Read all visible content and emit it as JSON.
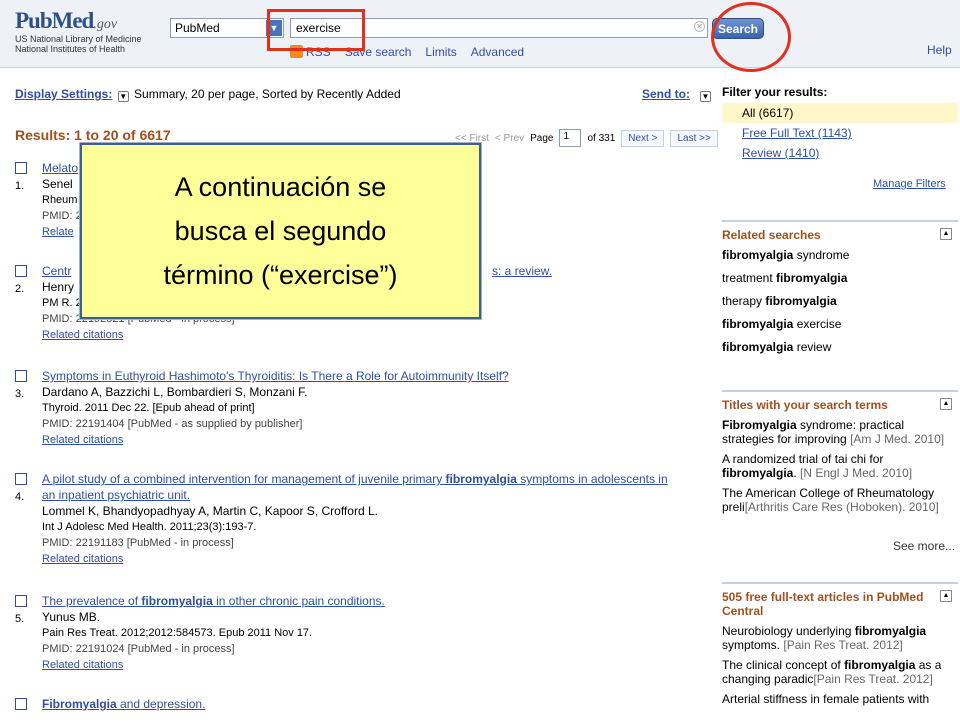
{
  "header": {
    "logo_main": "PubMed",
    "logo_suffix": ".gov",
    "logo_line1": "US National Library of Medicine",
    "logo_line2": "National Institutes of Health",
    "db_select": "PubMed",
    "search_value": "exercise",
    "search_button": "Search",
    "sublinks": [
      "RSS",
      "Save search",
      "Limits",
      "Advanced"
    ],
    "help": "Help"
  },
  "display": {
    "label": "Display Settings:",
    "summary": "Summary, 20 per page, Sorted by Recently Added",
    "send_to": "Send to:"
  },
  "results_header": "Results: 1 to 20 of 6617",
  "pager": {
    "first": "<< First",
    "prev": "< Prev",
    "page_label": "Page",
    "page_value": "1",
    "of": "of 331",
    "next": "Next >",
    "last": "Last >>"
  },
  "callout": {
    "line1": "A continuación se",
    "line2": "busca el segundo",
    "line3": "término (“exercise”)"
  },
  "results": [
    {
      "num": "1.",
      "title": "Melato",
      "authors": "Senel",
      "journal": "Rheum",
      "pmid": "PMID: 2",
      "related": "Relate"
    },
    {
      "num": "2.",
      "title_start": "Centr",
      "title_end": "s: a review.",
      "authors": "Henry",
      "journal": "PM R. 2",
      "pmid": "PMID: 22192321 [PubMed - in process]",
      "related": "Related citations"
    },
    {
      "num": "3.",
      "title": "Symptoms in Euthyroid Hashimoto's Thyroiditis: Is There a Role for Autoimmunity Itself?",
      "authors": "Dardano A, Bazzichi L, Bombardieri S, Monzani F.",
      "journal": "Thyroid. 2011 Dec 22. [Epub ahead of print]",
      "pmid": "PMID: 22191404 [PubMed - as supplied by publisher]",
      "related": "Related citations"
    },
    {
      "num": "4.",
      "title_a": "A pilot study of a combined intervention for management of juvenile primary ",
      "title_b": "fibromyalgia",
      "title_c": " symptoms in adolescents in an inpatient psychiatric unit.",
      "authors": "Lommel K, Bhandyopadhyay A, Martin C, Kapoor S, Crofford L.",
      "journal": "Int J Adolesc Med Health. 2011;23(3):193-7.",
      "pmid": "PMID: 22191183 [PubMed - in process]",
      "related": "Related citations"
    },
    {
      "num": "5.",
      "title_a": "The prevalence of ",
      "title_b": "fibromyalgia",
      "title_c": " in other chronic pain conditions.",
      "authors": "Yunus MB.",
      "journal": "Pain Res Treat. 2012;2012:584573. Epub 2011 Nov 17.",
      "pmid": "PMID: 22191024 [PubMed - in process]",
      "related": "Related citations"
    },
    {
      "num": "6.",
      "title_b": "Fibromyalgia",
      "title_c": " and depression."
    }
  ],
  "sidebar": {
    "filter_title": "Filter your results:",
    "filters": [
      "All (6617)",
      "Free Full Text (1143)",
      "Review (1410)"
    ],
    "manage_filters": "Manage Filters",
    "related_title": "Related searches",
    "related": [
      {
        "b": "fibromyalgia",
        "t": " syndrome"
      },
      {
        "t": "treatment ",
        "b": "fibromyalgia"
      },
      {
        "t": "therapy ",
        "b": "fibromyalgia"
      },
      {
        "b": "fibromyalgia",
        "t": " exercise"
      },
      {
        "b": "fibromyalgia",
        "t": " review"
      }
    ],
    "titles_title": "Titles with your search terms",
    "titles": [
      {
        "b": "Fibromyalgia",
        "t": " syndrome: practical strategies for improving ",
        "src": "[Am J Med. 2010]"
      },
      {
        "t": "A randomized trial of tai chi for ",
        "b": "fibromyalgia",
        "t2": ".",
        "src": "[N Engl J Med. 2010]"
      },
      {
        "t": "The American College of Rheumatology preli",
        "src": "[Arthritis Care Res (Hoboken). 2010]"
      }
    ],
    "see_more": "See more...",
    "pmc_title": "505 free full-text articles in PubMed Central",
    "pmc": [
      {
        "t": "Neurobiology underlying ",
        "b": "fibromyalgia",
        "t2": " symptoms.",
        "src": "[Pain Res Treat. 2012]"
      },
      {
        "t": "The clinical concept of ",
        "b": "fibromyalgia",
        "t2": " as a changing paradic",
        "src": "[Pain Res Treat. 2012]"
      },
      {
        "t": "Arterial stiffness in female patients with"
      }
    ]
  }
}
